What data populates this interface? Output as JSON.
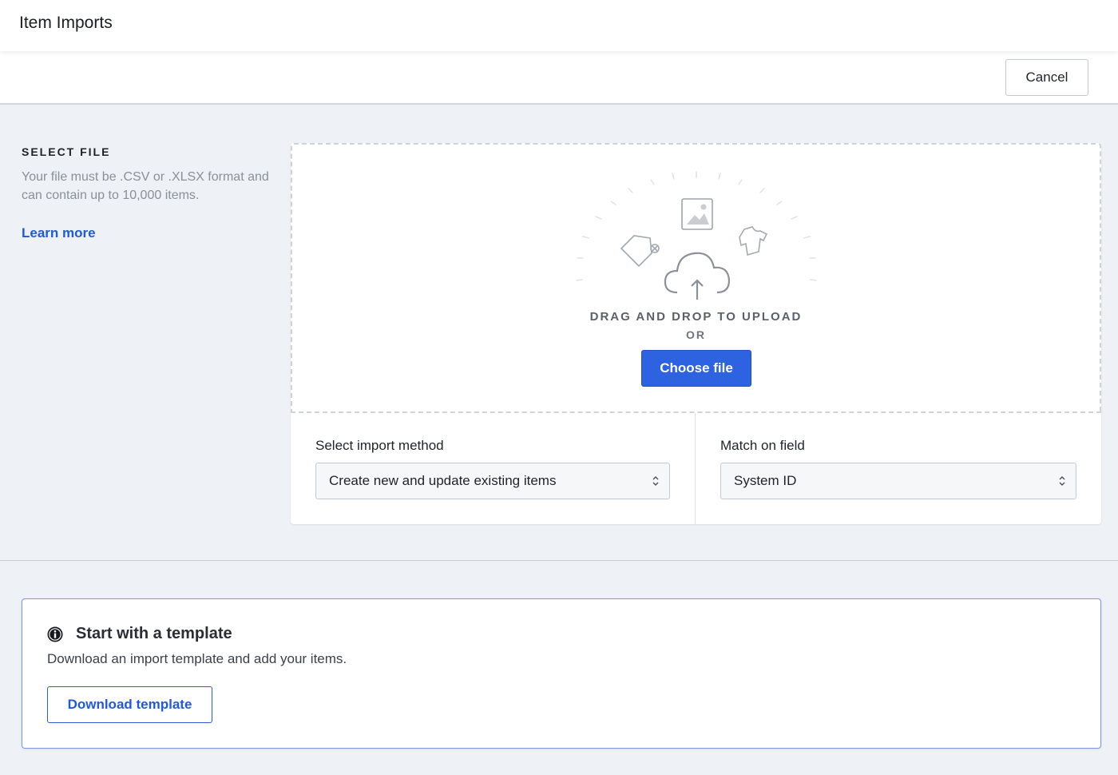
{
  "header": {
    "title": "Item Imports"
  },
  "toolbar": {
    "cancel_label": "Cancel"
  },
  "select_file": {
    "heading": "SELECT FILE",
    "description": "Your file must be .CSV or .XLSX format and can contain up to 10,000 items.",
    "learn_more": "Learn more"
  },
  "dropzone": {
    "drag_text": "DRAG AND DROP TO UPLOAD",
    "or_text": "OR",
    "choose_label": "Choose file",
    "illustration_icons": [
      "image-icon",
      "tag-icon",
      "shirt-icon",
      "cloud-upload-icon"
    ]
  },
  "import_options": {
    "method_label": "Select import method",
    "method_value": "Create new and update existing items",
    "match_label": "Match on field",
    "match_value": "System ID"
  },
  "template": {
    "title": "Start with a template",
    "description": "Download an import template and add your items.",
    "download_label": "Download template"
  },
  "colors": {
    "primary": "#2d62e0",
    "link": "#1f5bd7",
    "page_bg": "#eef1f5",
    "template_border": "#7b98e6"
  }
}
